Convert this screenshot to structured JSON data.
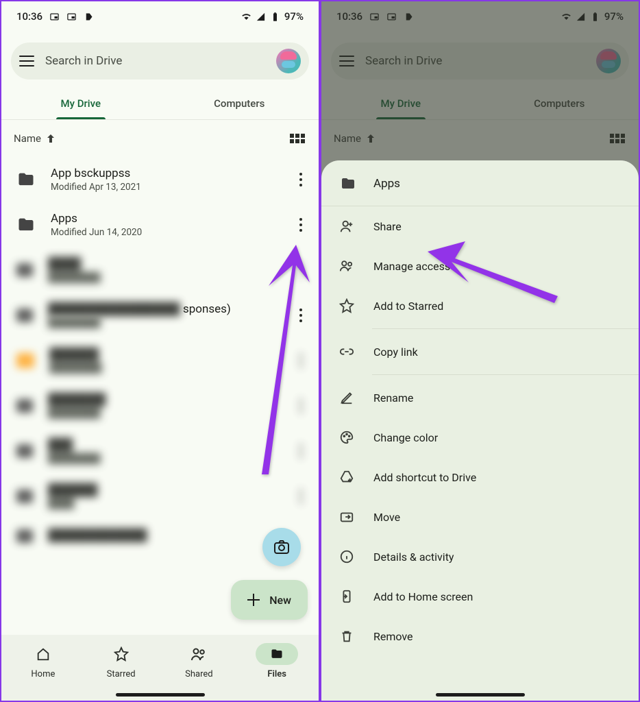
{
  "status": {
    "time": "10:36",
    "battery": "97%"
  },
  "search": {
    "placeholder": "Search in Drive"
  },
  "tabs": {
    "myDrive": "My Drive",
    "computers": "Computers"
  },
  "sort": {
    "label": "Name"
  },
  "files": [
    {
      "name": "App bsckuppss",
      "sub": "Modified Apr 13, 2021"
    },
    {
      "name": "Apps",
      "sub": "Modified Jun 14, 2020"
    }
  ],
  "blurTail": "sponses)",
  "fab": {
    "new": "New"
  },
  "nav": {
    "home": "Home",
    "starred": "Starred",
    "shared": "Shared",
    "files": "Files"
  },
  "sheet": {
    "title": "Apps",
    "share": "Share",
    "manage": "Manage access",
    "starred": "Add to Starred",
    "copy": "Copy link",
    "rename": "Rename",
    "color": "Change color",
    "shortcut": "Add shortcut to Drive",
    "move": "Move",
    "details": "Details & activity",
    "homescreen": "Add to Home screen",
    "remove": "Remove"
  }
}
